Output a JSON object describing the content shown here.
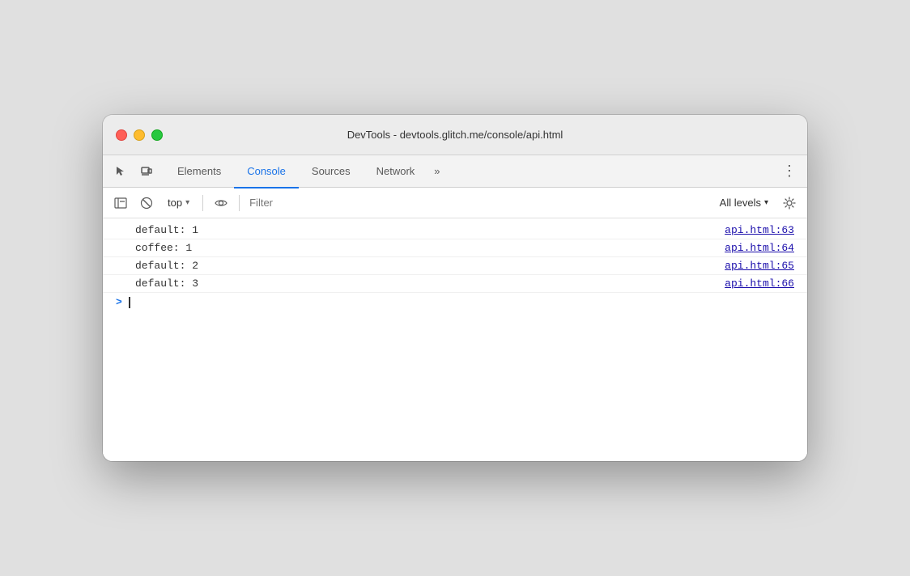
{
  "window": {
    "title": "DevTools - devtools.glitch.me/console/api.html"
  },
  "tabs": [
    {
      "id": "elements",
      "label": "Elements",
      "active": false
    },
    {
      "id": "console",
      "label": "Console",
      "active": true
    },
    {
      "id": "sources",
      "label": "Sources",
      "active": false
    },
    {
      "id": "network",
      "label": "Network",
      "active": false
    }
  ],
  "tabbar": {
    "more_label": "»",
    "menu_label": "⋮"
  },
  "console_toolbar": {
    "context": "top",
    "filter_placeholder": "Filter",
    "levels_label": "All levels"
  },
  "log_entries": [
    {
      "text": "default: 1",
      "link": "api.html:63"
    },
    {
      "text": "coffee: 1",
      "link": "api.html:64"
    },
    {
      "text": "default: 2",
      "link": "api.html:65"
    },
    {
      "text": "default: 3",
      "link": "api.html:66"
    }
  ],
  "console_prompt": ">",
  "icons": {
    "select_element": "⊡",
    "device_toolbar": "▭",
    "clear": "🚫",
    "sidebar": "▤",
    "eye": "👁",
    "chevron_down": "▾",
    "gear": "⚙"
  },
  "colors": {
    "active_tab": "#1a73e8",
    "link": "#1a0dab",
    "prompt": "#1a73e8"
  }
}
